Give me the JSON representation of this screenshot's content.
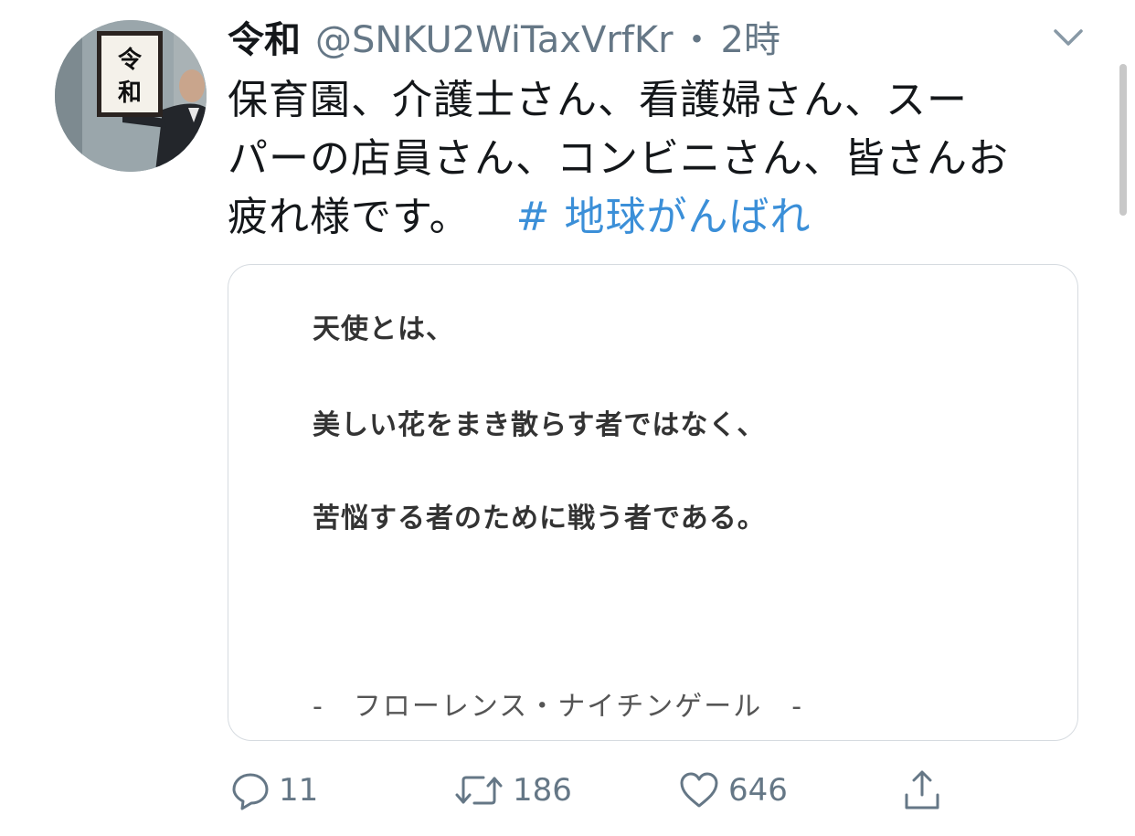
{
  "tweet": {
    "author_name": "令和",
    "handle": "@SNKU2WiTaxVrfKr",
    "separator": "・",
    "time": "2時",
    "text_line1": "保育園、介護士さん、看護婦さん、スー",
    "text_line2": "パーの店員さん、コンビニさん、皆さんお",
    "text_line3": "疲れ様です。",
    "hashtag": "# 地球がんばれ",
    "avatar_sign_text": "令和"
  },
  "card": {
    "line1": "天使とは、",
    "line2": "美しい花をまき散らす者ではなく、",
    "line3": "苦悩する者のために戦う者である。",
    "attribution": "-　フローレンス・ナイチンゲール　-"
  },
  "actions": {
    "reply_count": "11",
    "retweet_count": "186",
    "like_count": "646"
  },
  "icons": {
    "avatar": "avatar-photo",
    "more": "chevron-down-icon",
    "reply": "reply-icon",
    "retweet": "retweet-icon",
    "like": "heart-icon",
    "share": "share-icon"
  },
  "colors": {
    "hashtag": "#3b8fd8",
    "secondary_text": "#657786",
    "card_border": "#d6dbe0"
  }
}
